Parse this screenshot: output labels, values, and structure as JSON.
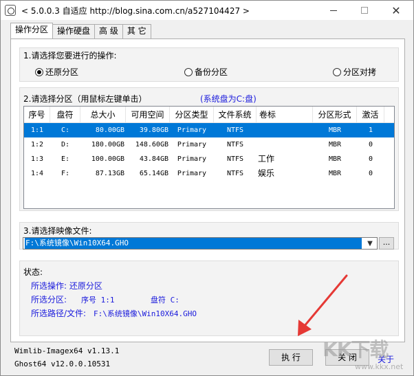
{
  "window": {
    "title": "< 5.0.0.3 自适应 http://blog.sina.com.cn/a527104427 >"
  },
  "tabs": [
    {
      "label": "操作分区",
      "active": true
    },
    {
      "label": "操作硬盘",
      "active": false
    },
    {
      "label": "高 级",
      "active": false
    },
    {
      "label": "其 它",
      "active": false
    }
  ],
  "operation": {
    "label": "1.请选择您要进行的操作:",
    "options": [
      {
        "label": "还原分区",
        "checked": true
      },
      {
        "label": "备份分区",
        "checked": false
      },
      {
        "label": "分区对拷",
        "checked": false
      }
    ]
  },
  "partition": {
    "label": "2.请选择分区（用鼠标左键单击）",
    "system_note": "(系统盘为C:盘)",
    "columns": [
      "序号",
      "盘符",
      "总大小",
      "可用空间",
      "分区类型",
      "文件系统",
      "卷标",
      "分区形式",
      "激活"
    ],
    "rows": [
      {
        "index": "1:1",
        "drive": "C:",
        "total": "80.00GB",
        "free": "39.80GB",
        "type": "Primary",
        "fs": "NTFS",
        "label": "",
        "form": "MBR",
        "active": "1",
        "selected": true
      },
      {
        "index": "1:2",
        "drive": "D:",
        "total": "180.00GB",
        "free": "148.60GB",
        "type": "Primary",
        "fs": "NTFS",
        "label": "",
        "form": "MBR",
        "active": "0",
        "selected": false
      },
      {
        "index": "1:3",
        "drive": "E:",
        "total": "100.00GB",
        "free": "43.84GB",
        "type": "Primary",
        "fs": "NTFS",
        "label": "工作",
        "form": "MBR",
        "active": "0",
        "selected": false
      },
      {
        "index": "1:4",
        "drive": "F:",
        "total": "87.13GB",
        "free": "65.14GB",
        "type": "Primary",
        "fs": "NTFS",
        "label": "娱乐",
        "form": "MBR",
        "active": "0",
        "selected": false
      }
    ]
  },
  "image_file": {
    "label": "3.请选择映像文件:",
    "value": "F:\\系统镜像\\Win10X64.GHO",
    "browse_label": "..."
  },
  "status": {
    "label": "状态:",
    "op_line": "所选操作: 还原分区",
    "part_label": "所选分区:",
    "part_index": "序号 1:1",
    "part_drive": "盘符 C:",
    "path_label": "所选路径/文件:",
    "path_value": "F:\\系统镜像\\Win10X64.GHO"
  },
  "versions": {
    "wimlib": "Wimlib-Imagex64 v1.13.1",
    "ghost": "Ghost64 v12.0.0.10531"
  },
  "buttons": {
    "execute": "执 行",
    "close": "关 闭",
    "about": "关于"
  },
  "watermark": {
    "brand": "KK下载",
    "url": "www.kkx.net"
  },
  "colors": {
    "selection": "#0078d7",
    "link_blue": "#1a1adc",
    "annotation_arrow": "#e53935"
  }
}
